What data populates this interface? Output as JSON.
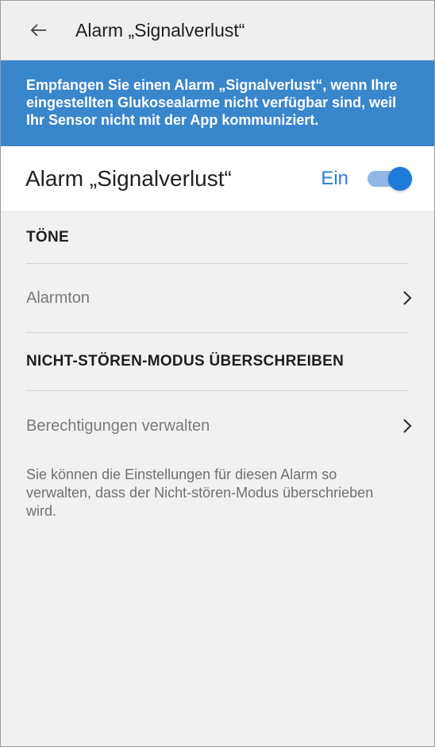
{
  "header": {
    "title": "Alarm „Signalverlust“",
    "back_icon": "arrow-left-icon"
  },
  "banner": {
    "text": "Empfangen Sie einen Alarm „Signalverlust“, wenn Ihre eingestellten Glukosealarme nicht verfügbar sind, weil Ihr Sensor nicht mit der App kommuniziert."
  },
  "toggle": {
    "label": "Alarm „Signalverlust“",
    "state_text": "Ein",
    "on": true
  },
  "sections": {
    "tones_title": "TÖNE",
    "alarm_tone_label": "Alarmton",
    "dnd_title": "NICHT-STÖREN-MODUS ÜBERSCHREIBEN",
    "permissions_label": "Berechtigungen verwalten",
    "dnd_description": "Sie können die Einstellungen für diesen Alarm so verwalten, dass der Nicht-stören-Modus überschrieben wird."
  },
  "colors": {
    "accent": "#3a86cc",
    "switch_on": "#1e7ad8"
  }
}
